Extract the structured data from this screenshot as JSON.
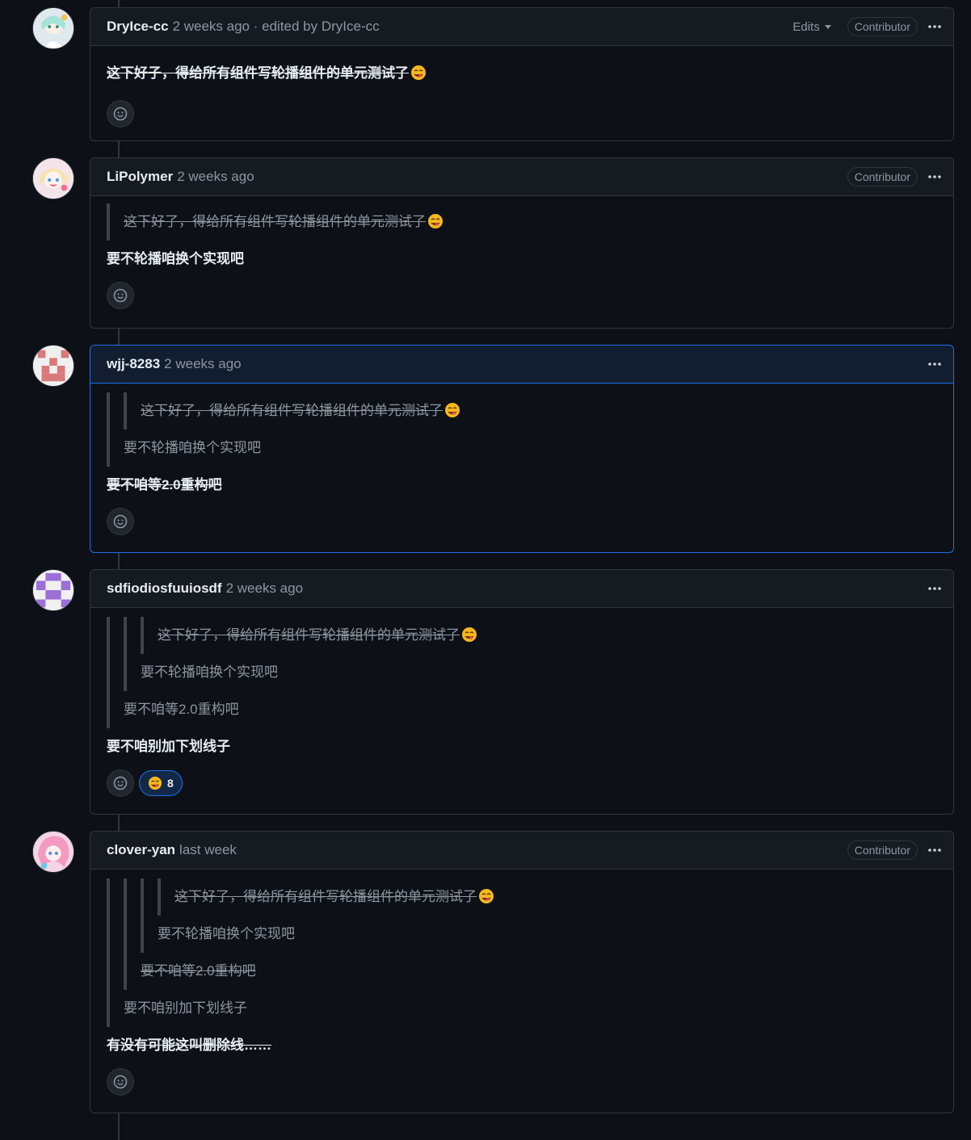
{
  "comments": [
    {
      "author": "DryIce-cc",
      "meta": "2 weeks ago · edited by DryIce-cc",
      "edits_label": "Edits",
      "badge": "Contributor",
      "quotes": [],
      "text": "这下好子，得给所有组件写轮播组件的单元测试了",
      "avatar_color": "#dfe9ee"
    },
    {
      "author": "LiPolymer",
      "meta": "2 weeks ago",
      "badge": "Contributor",
      "quotes": [
        "这下好了，得给所有组件写轮播组件的单元测试了"
      ],
      "text": "要不轮播咱换个实现吧",
      "avatar_color": "#f3e4ea"
    },
    {
      "author": "wjj-8283",
      "meta": "2 weeks ago",
      "quotes": [
        "这下好了，得给所有组件写轮播组件的单元测试了",
        "要不轮播咱换个实现吧"
      ],
      "text": "要不咱等2.0重构吧",
      "avatar_color": "#d97a7a"
    },
    {
      "author": "sdfiodiosfuuiosdf",
      "meta": "2 weeks ago",
      "quotes": [
        "这下好了，得给所有组件写轮播组件的单元测试了",
        "要不轮播咱换个实现吧",
        "要不咱等2.0重构吧"
      ],
      "text": "要不咱别加下划线子",
      "reaction_count": "8",
      "avatar_color": "#9b6fd6"
    },
    {
      "author": "clover-yan",
      "meta": "last week",
      "badge": "Contributor",
      "quotes": [
        "这下好了，得给所有组件写轮播组件的单元测试了",
        "要不轮播咱换个实现吧",
        "要不咱等2.0重构吧",
        "要不咱别加下划线子"
      ],
      "text": "有没有可能这叫删除线……",
      "avatar_color": "#f4b6cf"
    }
  ],
  "icons": {
    "kebab": "kebab-horizontal-icon",
    "smiley": "smiley-icon",
    "reaction_emoji": "face-savoring-food-emoji"
  },
  "colors": {
    "background": "#0d1117",
    "header_bg": "#161b22",
    "border": "#30363d",
    "highlight_border": "#1f6feb",
    "text_muted": "#8d96a0"
  }
}
